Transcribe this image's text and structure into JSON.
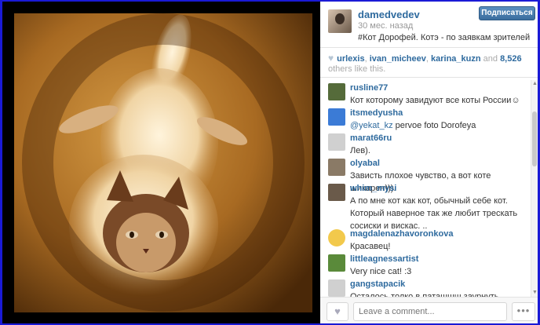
{
  "post": {
    "username": "damedvedev",
    "time": "30 мес. назад",
    "caption": "#Кот Дорофей. Котэ - по заявкам зрителей",
    "follow_label": "Подписаться"
  },
  "likes": {
    "users": [
      "urlexis",
      "ivan_micheev",
      "karina_kuzn"
    ],
    "sep1": ", ",
    "sep2": ", ",
    "and_text": " and ",
    "count_text": "8,526",
    "suffix": " others like this."
  },
  "comments": [
    {
      "user": "rusline77",
      "text": "Кот которому завидуют все коты России☺",
      "avatar_color": "#556b3a"
    },
    {
      "user": "itsmedyusha",
      "mention": "@yekat_kz",
      "text": " pervoe foto Dorofeya",
      "avatar_color": "#3b7bd6"
    },
    {
      "user": "marat66ru",
      "text": "Лев).",
      "avatar_color": "#d0d0d0"
    },
    {
      "user": "olyabal",
      "text": "Зависть плохое чувство, а вот коте шикарен))).",
      "avatar_color": "#8a7a66"
    },
    {
      "user": "whim_mysi",
      "text": "А по мне кот как кот, обычный себе кот. Который наверное так же любит трескать сосиски и вискас. ..",
      "avatar_color": "#6a5a4a"
    },
    {
      "user": "magdalenazhavoronkova",
      "text": "Красавец!",
      "avatar_color": "#f2c94c"
    },
    {
      "user": "littleagnessartist",
      "text": "Very nice cat! :3",
      "avatar_color": "#5a8a3a"
    },
    {
      "user": "gangstapacik",
      "text": "Осталось толко в паташшш заурнуть",
      "avatar_color": "#d0d0d0"
    }
  ],
  "footer": {
    "comment_placeholder": "Leave a comment...",
    "more_label": "•••"
  },
  "icons": {
    "like": "heart-icon",
    "more": "ellipsis-icon",
    "likes_heart": "heart-icon"
  },
  "colors": {
    "link": "#2e6a9e",
    "follow_button": "#3b6e9e",
    "background_border": "#1a1ad6"
  }
}
